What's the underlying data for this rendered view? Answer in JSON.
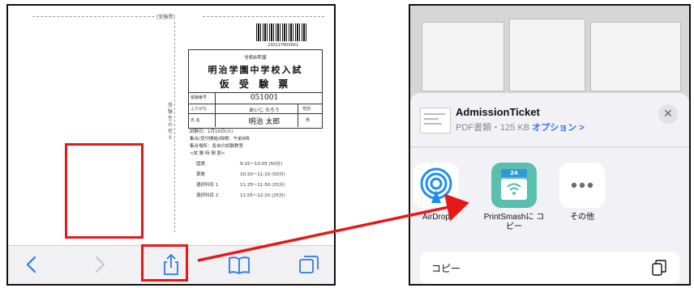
{
  "left": {
    "ticket": {
      "header_label": "[受験票]",
      "barcode_number": "230117800001",
      "year": "令和6年度",
      "title": "明治学園中学校入試",
      "subtitle": "仮 受 験 票",
      "rows": [
        {
          "label": "受験番号",
          "value": "051001"
        },
        {
          "label": "ふりがな",
          "value": "めいじ たろう",
          "extra": "性別"
        },
        {
          "label": "氏 名",
          "value": "明治 太郎",
          "extra": "男"
        }
      ],
      "side_text": "受験生の控え",
      "info_lines": [
        "試験日：1月16日(火)",
        "集合(受付開始)時間：午前8時",
        "集合場所：各自の試験教室",
        "<試 験 時 間 割>"
      ],
      "schedule": [
        {
          "subject": "国語",
          "time": "9:15〜10:05 (50分)"
        },
        {
          "subject": "算数",
          "time": "10:20〜11:10 (50分)"
        },
        {
          "subject": "選択科目 1",
          "time": "11:25〜11:50 (25分)"
        },
        {
          "subject": "選択科目 2",
          "time": "11:55〜12:20 (25分)"
        }
      ]
    },
    "toolbar_icons": [
      "back-icon",
      "forward-icon",
      "share-icon",
      "bookmarks-icon",
      "tabs-icon"
    ]
  },
  "share_sheet": {
    "file_name": "AdmissionTicket",
    "file_meta": "PDF書類・125 KB ",
    "option_label": "オプション >",
    "apps": [
      {
        "name": "airdrop",
        "label": "AirDrop"
      },
      {
        "name": "printsmash",
        "label": "PrintSmashに コピー",
        "badge": "24"
      },
      {
        "name": "more",
        "label": "その他"
      }
    ],
    "copy_label": "コピー"
  },
  "colors": {
    "highlight": "#e81818",
    "ios_blue": "#2e78f0",
    "printsmash_teal": "#5bbfb0"
  }
}
